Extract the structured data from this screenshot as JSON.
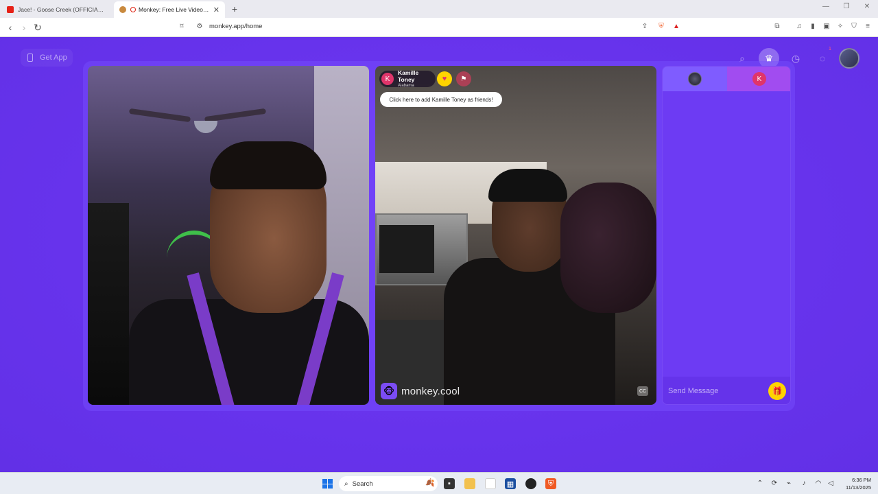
{
  "browser": {
    "tabs": [
      {
        "title": "Jace! - Goose Creek (OFFICIAL VIDEO",
        "icon": "youtube-icon",
        "active": false
      },
      {
        "title": "Monkey: Free Live Video Chat",
        "icon": "monkey-icon",
        "active": true
      }
    ],
    "url": "monkey.app/home"
  },
  "header": {
    "get_app_label": "Get App",
    "notification_count": "1"
  },
  "peer": {
    "initial": "K",
    "name": "Kamille Toney",
    "location": "Alabama",
    "add_friend_tooltip": "Click here to add Kamille Toney as friends!"
  },
  "watermark": {
    "text": "monkey.cool"
  },
  "chat": {
    "peer_initial": "K",
    "send_placeholder": "Send Message"
  },
  "taskbar": {
    "search_label": "Search",
    "time": "6:36 PM",
    "date": "11/13/2025"
  },
  "colors": {
    "page_bg": "#6b34f0",
    "accent_yellow": "#ffd400",
    "peer_avatar": "#e0356a",
    "chat_tab_left": "#7f5cff",
    "chat_tab_right": "#a14cf0"
  }
}
